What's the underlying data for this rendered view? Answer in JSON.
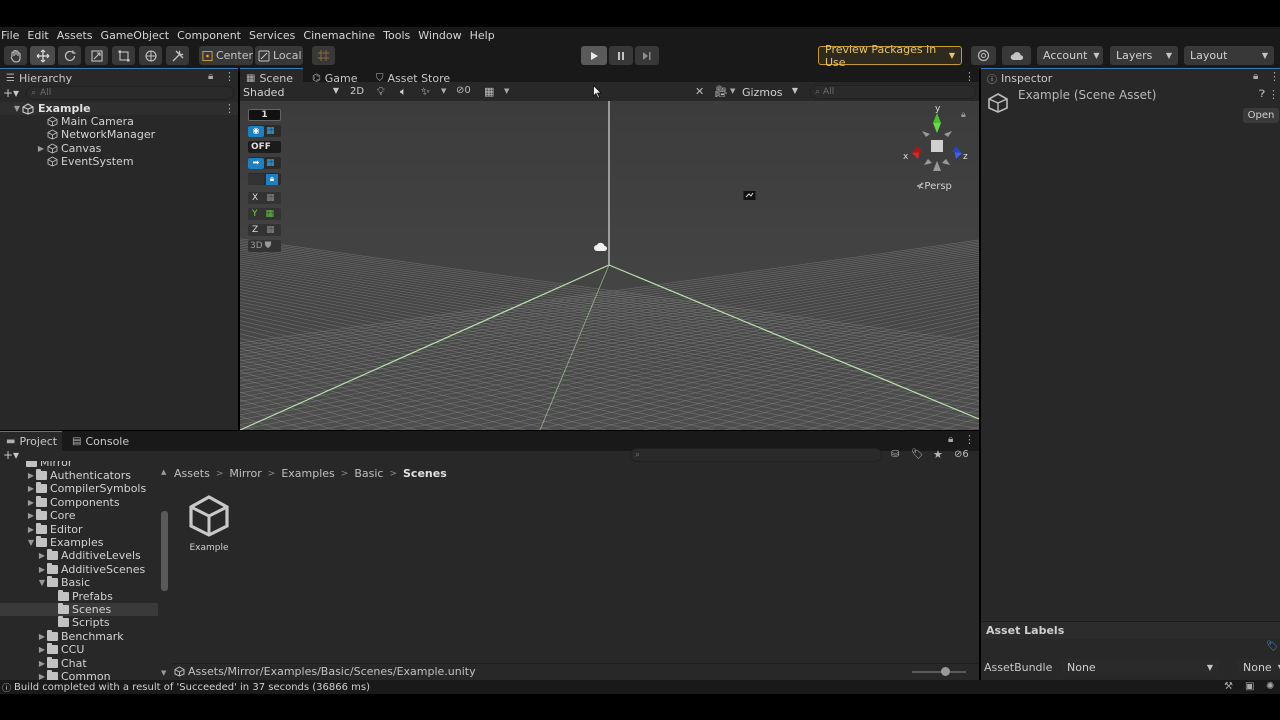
{
  "menubar": [
    "File",
    "Edit",
    "Assets",
    "GameObject",
    "Component",
    "Services",
    "Cinemachine",
    "Tools",
    "Window",
    "Help"
  ],
  "toolbar": {
    "pivot_label": "Center",
    "space_label": "Local",
    "preview_packages": "Preview Packages in Use",
    "account": "Account",
    "layers": "Layers",
    "layout": "Layout"
  },
  "hierarchy": {
    "title": "Hierarchy",
    "search_placeholder": "All",
    "scene": "Example",
    "items": [
      "Main Camera",
      "NetworkManager",
      "Canvas",
      "EventSystem"
    ]
  },
  "scene_view": {
    "tabs": [
      "Scene",
      "Game",
      "Asset Store"
    ],
    "shading": "Shaded",
    "mode_2d": "2D",
    "hidden_count": "0",
    "gizmos": "Gizmos",
    "search_placeholder": "All",
    "persp": "Persp",
    "overlay": {
      "snap_value": "1",
      "grid_off": "OFF",
      "x": "X",
      "y": "Y",
      "z": "Z",
      "mode_3d": "3D"
    },
    "axis_labels": {
      "x": "x",
      "y": "y",
      "z": "z"
    }
  },
  "inspector": {
    "title": "Inspector",
    "asset_title": "Example (Scene Asset)",
    "open_label": "Open",
    "asset_labels": "Asset Labels",
    "assetbundle_label": "AssetBundle",
    "assetbundle_value": "None",
    "variant_value": "None"
  },
  "project": {
    "tabs": [
      "Project",
      "Console"
    ],
    "tree_cut_top": "Mirror",
    "tree": [
      {
        "label": "Authenticators",
        "depth": 1,
        "expanded": false
      },
      {
        "label": "CompilerSymbols",
        "depth": 1,
        "expanded": false
      },
      {
        "label": "Components",
        "depth": 1,
        "expanded": false
      },
      {
        "label": "Core",
        "depth": 1,
        "expanded": false
      },
      {
        "label": "Editor",
        "depth": 1,
        "expanded": false
      },
      {
        "label": "Examples",
        "depth": 1,
        "expanded": true
      },
      {
        "label": "AdditiveLevels",
        "depth": 2,
        "expanded": false
      },
      {
        "label": "AdditiveScenes",
        "depth": 2,
        "expanded": false
      },
      {
        "label": "Basic",
        "depth": 2,
        "expanded": true
      },
      {
        "label": "Prefabs",
        "depth": 3,
        "expanded": false
      },
      {
        "label": "Scenes",
        "depth": 3,
        "expanded": false
      },
      {
        "label": "Scripts",
        "depth": 3,
        "expanded": false
      },
      {
        "label": "Benchmark",
        "depth": 2,
        "expanded": false
      },
      {
        "label": "CCU",
        "depth": 2,
        "expanded": false
      },
      {
        "label": "Chat",
        "depth": 2,
        "expanded": false
      },
      {
        "label": "Common",
        "depth": 2,
        "expanded": false
      }
    ],
    "breadcrumb": [
      "Assets",
      "Mirror",
      "Examples",
      "Basic",
      "Scenes"
    ],
    "asset_name": "Example",
    "hidden_count": "6",
    "path": "Assets/Mirror/Examples/Basic/Scenes/Example.unity"
  },
  "status": {
    "message": "Build completed with a result of 'Succeeded' in 37 seconds (36866 ms)"
  },
  "colors": {
    "selection_blue": "#3a79bb",
    "preview_packages_border": "#c69c2e",
    "axis_red": "#d02020",
    "axis_green": "#5ccf2e",
    "axis_blue": "#3f62e8"
  }
}
